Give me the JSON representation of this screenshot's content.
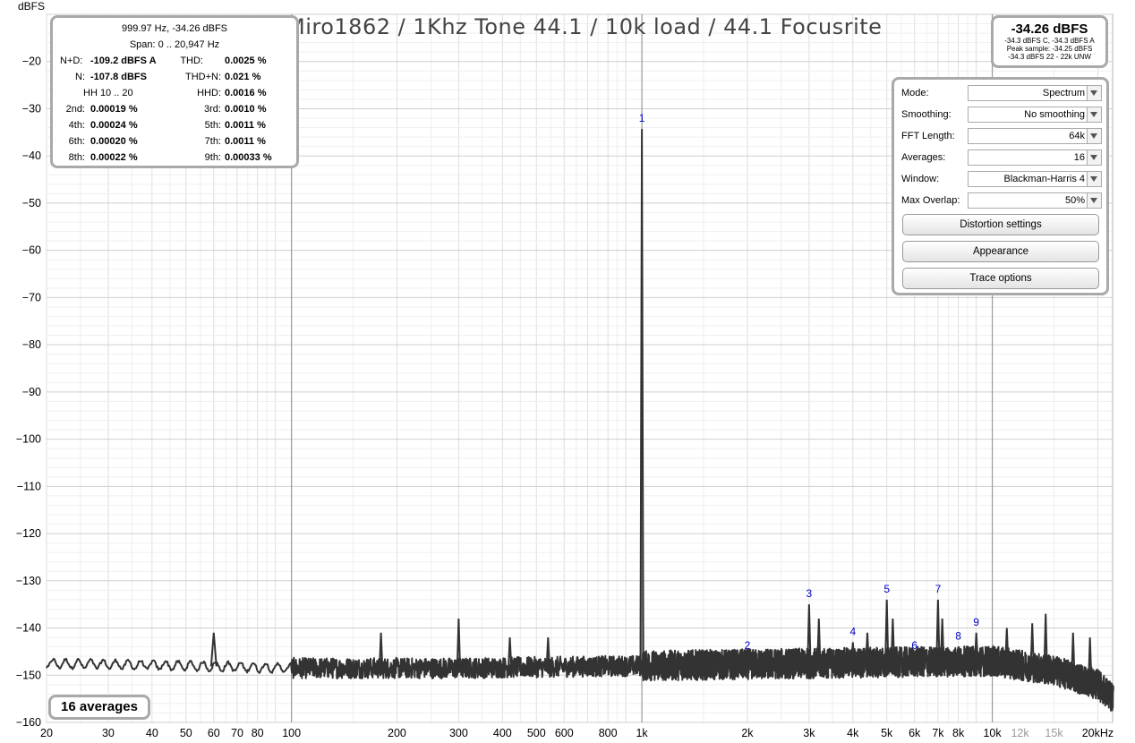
{
  "chart_data": {
    "type": "line",
    "title": "Miro1862 / 1Khz Tone 44.1 / 10k load / 44.1 Focusrite",
    "ylabel": "dBFS",
    "xscale": "log",
    "xlim": [
      20,
      22050
    ],
    "ylim": [
      -160,
      -10
    ],
    "grid": true,
    "y_ticks": [
      "-20",
      "-30",
      "-40",
      "-50",
      "-60",
      "-70",
      "-80",
      "-90",
      "-100",
      "-110",
      "-120",
      "-130",
      "-140",
      "-150",
      "-160"
    ],
    "x_ticks": [
      {
        "f": 20,
        "label": "20",
        "major": false
      },
      {
        "f": 30,
        "label": "30",
        "major": false
      },
      {
        "f": 40,
        "label": "40",
        "major": false
      },
      {
        "f": 50,
        "label": "50",
        "major": false
      },
      {
        "f": 60,
        "label": "60",
        "major": false
      },
      {
        "f": 70,
        "label": "70",
        "major": false
      },
      {
        "f": 80,
        "label": "80",
        "major": false
      },
      {
        "f": 100,
        "label": "100",
        "major": true
      },
      {
        "f": 200,
        "label": "200",
        "major": false
      },
      {
        "f": 300,
        "label": "300",
        "major": false
      },
      {
        "f": 400,
        "label": "400",
        "major": false
      },
      {
        "f": 500,
        "label": "500",
        "major": false
      },
      {
        "f": 600,
        "label": "600",
        "major": false
      },
      {
        "f": 800,
        "label": "800",
        "major": false
      },
      {
        "f": 1000,
        "label": "1k",
        "major": true
      },
      {
        "f": 2000,
        "label": "2k",
        "major": false
      },
      {
        "f": 3000,
        "label": "3k",
        "major": false
      },
      {
        "f": 4000,
        "label": "4k",
        "major": false
      },
      {
        "f": 5000,
        "label": "5k",
        "major": false
      },
      {
        "f": 6000,
        "label": "6k",
        "major": false
      },
      {
        "f": 7000,
        "label": "7k",
        "major": false
      },
      {
        "f": 8000,
        "label": "8k",
        "major": false
      },
      {
        "f": 10000,
        "label": "10k",
        "major": true
      },
      {
        "f": 12000,
        "label": "12k",
        "major": false,
        "grey": true
      },
      {
        "f": 15000,
        "label": "15k",
        "major": false,
        "grey": true
      },
      {
        "f": 20000,
        "label": "20kHz",
        "major": false
      }
    ],
    "series": [
      {
        "color": "#333333",
        "noise_floor": [
          [
            20,
            -147.5
          ],
          [
            50,
            -148
          ],
          [
            100,
            -148.5
          ],
          [
            300,
            -148.5
          ],
          [
            1000,
            -148
          ],
          [
            3000,
            -147.5
          ],
          [
            10000,
            -147
          ],
          [
            15000,
            -149
          ],
          [
            20000,
            -152
          ],
          [
            22050,
            -155
          ]
        ],
        "peaks": [
          {
            "f": 60,
            "db": -141
          },
          {
            "f": 180,
            "db": -141
          },
          {
            "f": 300,
            "db": -138
          },
          {
            "f": 420,
            "db": -142
          },
          {
            "f": 540,
            "db": -142
          },
          {
            "f": 1000,
            "db": -34.3
          },
          {
            "f": 2000,
            "db": -146
          },
          {
            "f": 3000,
            "db": -135
          },
          {
            "f": 3200,
            "db": -138
          },
          {
            "f": 4000,
            "db": -143
          },
          {
            "f": 4400,
            "db": -141
          },
          {
            "f": 5000,
            "db": -134
          },
          {
            "f": 5200,
            "db": -138
          },
          {
            "f": 6000,
            "db": -146
          },
          {
            "f": 7000,
            "db": -134
          },
          {
            "f": 7200,
            "db": -138
          },
          {
            "f": 8000,
            "db": -144
          },
          {
            "f": 9000,
            "db": -141
          },
          {
            "f": 11000,
            "db": -140
          },
          {
            "f": 13000,
            "db": -139
          },
          {
            "f": 14200,
            "db": -137
          },
          {
            "f": 17000,
            "db": -141
          },
          {
            "f": 19000,
            "db": -142
          }
        ]
      }
    ],
    "annotations": [
      {
        "text": "1",
        "f": 1000,
        "db": -34.3
      },
      {
        "text": "2",
        "f": 2000,
        "db": -146
      },
      {
        "text": "3",
        "f": 3000,
        "db": -135
      },
      {
        "text": "4",
        "f": 4000,
        "db": -143
      },
      {
        "text": "5",
        "f": 5000,
        "db": -134
      },
      {
        "text": "6",
        "f": 6000,
        "db": -146
      },
      {
        "text": "7",
        "f": 7000,
        "db": -134
      },
      {
        "text": "8",
        "f": 8000,
        "db": -144
      },
      {
        "text": "9",
        "f": 9000,
        "db": -141
      }
    ]
  },
  "stats": {
    "freq_level": "999.97 Hz, -34.26 dBFS",
    "span": "Span: 0 .. 20,947 Hz",
    "nd_label": "N+D:",
    "nd_value": "-109.2 dBFS A",
    "thd_label": "THD:",
    "thd_value": "0.0025 %",
    "n_label": "N:",
    "n_value": "-107.8 dBFS",
    "thdn_label": "THD+N:",
    "thdn_value": "0.021 %",
    "hh_label": "HH 10 .. 20",
    "hhd_label": "HHD:",
    "hhd_value": "0.0016 %",
    "h2_label": "2nd:",
    "h2_value": "0.00019 %",
    "h3_label": "3rd:",
    "h3_value": "0.0010 %",
    "h4_label": "4th:",
    "h4_value": "0.00024 %",
    "h5_label": "5th:",
    "h5_value": "0.0011 %",
    "h6_label": "6th:",
    "h6_value": "0.00020 %",
    "h7_label": "7th:",
    "h7_value": "0.0011 %",
    "h8_label": "8th:",
    "h8_value": "0.00022 %",
    "h9_label": "9th:",
    "h9_value": "0.00033 %"
  },
  "level": {
    "main": "-34.26 dBFS",
    "line1": "-34.3 dBFS C, -34.3 dBFS A",
    "line2": "Peak sample: -34.25 dBFS",
    "line3": "-34.3 dBFS 22 - 22k UNW"
  },
  "controls": {
    "mode_label": "Mode:",
    "mode_value": "Spectrum",
    "smoothing_label": "Smoothing:",
    "smoothing_value": "No smoothing",
    "fft_label": "FFT Length:",
    "fft_value": "64k",
    "averages_label": "Averages:",
    "averages_value": "16",
    "window_label": "Window:",
    "window_value": "Blackman-Harris 4",
    "overlap_label": "Max Overlap:",
    "overlap_value": "50%",
    "distortion_button": "Distortion settings",
    "appearance_button": "Appearance",
    "trace_button": "Trace options"
  },
  "badge": "16 averages"
}
